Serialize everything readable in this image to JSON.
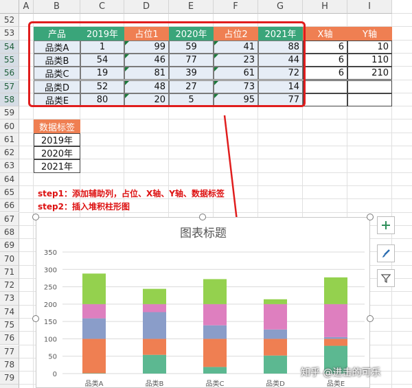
{
  "columns": [
    "A",
    "B",
    "C",
    "D",
    "E",
    "F",
    "G",
    "H",
    "I"
  ],
  "rows": [
    "52",
    "53",
    "54",
    "55",
    "56",
    "57",
    "58",
    "59",
    "60",
    "61",
    "62",
    "63",
    "64",
    "65",
    "66",
    "67",
    "68",
    "69",
    "70",
    "71",
    "72",
    "73",
    "74",
    "75",
    "76",
    "77",
    "78",
    "79",
    "80"
  ],
  "table": {
    "headers": [
      "产品",
      "2019年",
      "占位1",
      "2020年",
      "占位2",
      "2021年"
    ],
    "rows": [
      [
        "品类A",
        "1",
        "99",
        "59",
        "41",
        "88"
      ],
      [
        "品类B",
        "54",
        "46",
        "77",
        "23",
        "44"
      ],
      [
        "品类C",
        "19",
        "81",
        "39",
        "61",
        "72"
      ],
      [
        "品类D",
        "52",
        "48",
        "27",
        "73",
        "14"
      ],
      [
        "品类E",
        "80",
        "20",
        "5",
        "95",
        "77"
      ]
    ]
  },
  "axis_table": {
    "headers": [
      "X轴",
      "Y轴"
    ],
    "rows": [
      [
        "6",
        "10"
      ],
      [
        "6",
        "110"
      ],
      [
        "6",
        "210"
      ]
    ]
  },
  "label_table": {
    "header": "数据标签",
    "rows": [
      "2019年",
      "2020年",
      "2021年"
    ]
  },
  "steps": [
    "step1：添加辅助列，占位、X轴、Y轴、数据标签",
    "step2：插入堆积柱形图"
  ],
  "chart_data": {
    "type": "bar",
    "title": "图表标题",
    "categories": [
      "品类A",
      "品类B",
      "品类C",
      "品类D",
      "品类E"
    ],
    "series": [
      {
        "values": [
          1,
          54,
          19,
          52,
          80
        ],
        "color": "#5cb891"
      },
      {
        "values": [
          99,
          46,
          81,
          48,
          20
        ],
        "color": "#ef7f52"
      },
      {
        "values": [
          59,
          77,
          39,
          27,
          5
        ],
        "color": "#8a9dc9"
      },
      {
        "values": [
          41,
          23,
          61,
          73,
          95
        ],
        "color": "#de7fbf"
      },
      {
        "values": [
          88,
          44,
          72,
          14,
          77
        ],
        "color": "#94d14e"
      }
    ],
    "yticks": [
      "0",
      "50",
      "100",
      "150",
      "200",
      "250",
      "300",
      "350"
    ],
    "ylim": [
      0,
      350
    ]
  },
  "side_buttons": [
    "plus-icon",
    "brush-icon",
    "filter-icon"
  ],
  "watermark": "知乎 @进击的可乐"
}
